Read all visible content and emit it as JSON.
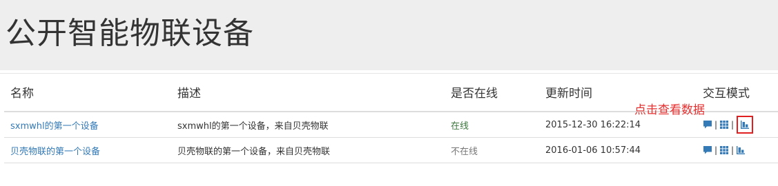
{
  "page": {
    "title": "公开智能物联设备"
  },
  "table": {
    "headers": [
      "名称",
      "描述",
      "是否在线",
      "更新时间",
      "交互模式"
    ],
    "rows": [
      {
        "name": "sxmwhl的第一个设备",
        "description": "sxmwhl的第一个设备，来自贝壳物联",
        "status": "在线",
        "updated": "2015-12-30 16:22:14"
      },
      {
        "name": "贝壳物联的第一个设备",
        "description": "贝壳物联的第一个设备，来自贝壳物联",
        "status": "不在线",
        "updated": "2016-01-06 10:57:44"
      }
    ],
    "separator": "|"
  },
  "annotation": {
    "text": "点击查看数据",
    "color": "#e53030"
  },
  "icons": {
    "chat": "chat-icon",
    "grid": "grid-icon",
    "chart": "chart-icon"
  },
  "colors": {
    "link": "#337ab7",
    "online": "#3c763d",
    "offline": "#777777",
    "hero_bg": "#eeeeee"
  }
}
